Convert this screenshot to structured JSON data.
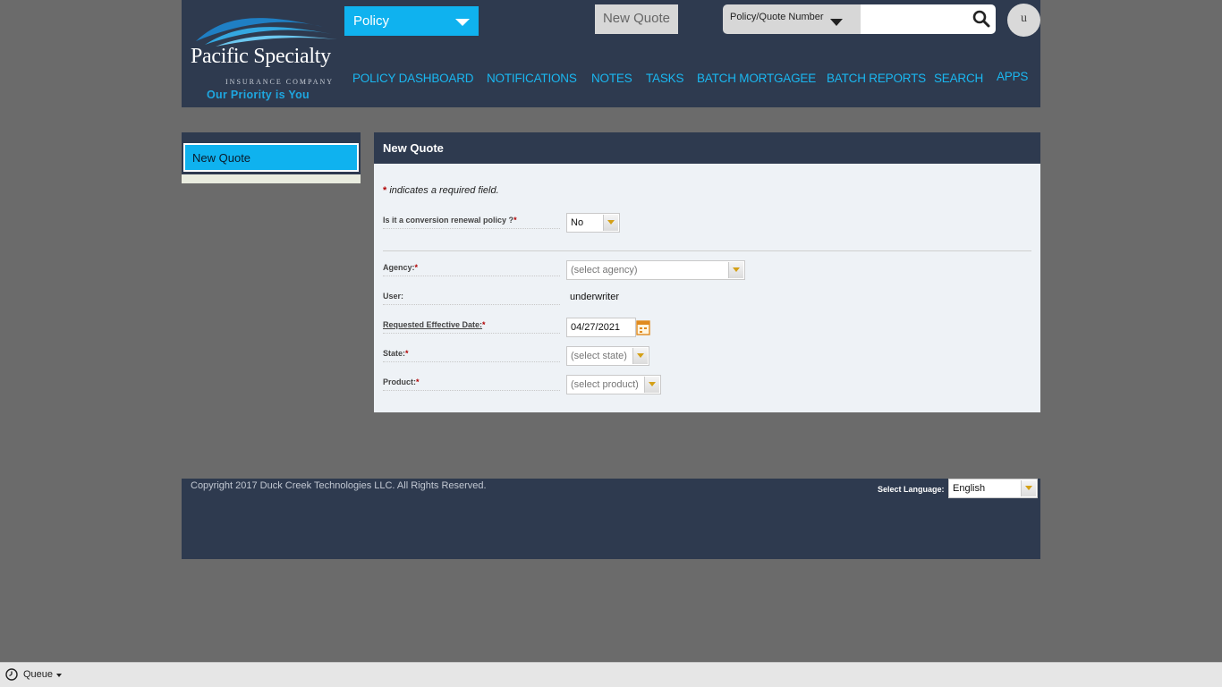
{
  "header": {
    "logo": {
      "name": "Pacific Specialty",
      "subtitle": "INSURANCE COMPANY",
      "tagline": "Our Priority is You"
    },
    "module_select": "Policy",
    "new_quote_button": "New Quote",
    "search": {
      "type": "Policy/Quote Number",
      "placeholder": "",
      "value": ""
    },
    "user_avatar": "u"
  },
  "nav": [
    {
      "label": "POLICY DASHBOARD"
    },
    {
      "label": "NOTIFICATIONS"
    },
    {
      "label": "NOTES"
    },
    {
      "label": "TASKS"
    },
    {
      "label": "BATCH MORTGAGEE"
    },
    {
      "label": "BATCH REPORTS"
    },
    {
      "label": "SEARCH"
    },
    {
      "label": "APPS"
    }
  ],
  "sidebar": {
    "items": [
      {
        "label": "New Quote"
      }
    ]
  },
  "panel": {
    "title": "New Quote",
    "required_star": "*",
    "required_note": "indicates a required field.",
    "fields": {
      "conversion": {
        "label": "Is it a conversion renewal policy ?",
        "value": "No"
      },
      "agency": {
        "label": "Agency:",
        "value": "(select agency)"
      },
      "user": {
        "label": "User:",
        "value": "underwriter"
      },
      "effective_date": {
        "label": "Requested Effective Date:",
        "value": "04/27/2021"
      },
      "state": {
        "label": "State:",
        "value": "(select state)"
      },
      "product": {
        "label": "Product:",
        "value": "(select product)"
      }
    }
  },
  "footer": {
    "copyright": "Copyright 2017 Duck Creek Technologies LLC. All Rights Reserved.",
    "language_label": "Select Language:",
    "language_value": "English"
  },
  "taskbar": {
    "queue_label": "Queue"
  },
  "colors": {
    "header_bg": "#2e3a4f",
    "accent": "#0fb2ef",
    "nav_link": "#1ab7f0",
    "required": "#b00000"
  }
}
